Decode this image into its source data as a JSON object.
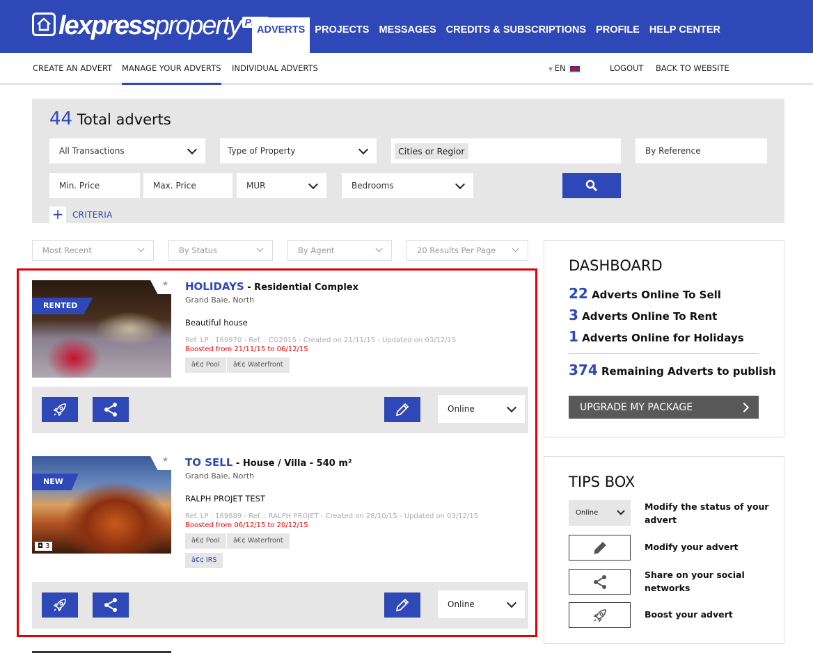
{
  "brand": {
    "name_bold": "lexpress",
    "name_light": "property",
    "pro": "PRO"
  },
  "main_nav": [
    "ADVERTS",
    "PROJECTS",
    "MESSAGES",
    "CREDITS & SUBSCRIPTIONS",
    "PROFILE",
    "HELP CENTER"
  ],
  "sub_nav": {
    "create": "CREATE AN ADVERT",
    "manage": "MANAGE YOUR ADVERTS",
    "individual": "INDIVIDUAL ADVERTS",
    "lang": "EN",
    "logout": "LOGOUT",
    "back": "BACK TO WEBSITE"
  },
  "search": {
    "total_count": "44",
    "total_label": "Total adverts",
    "transactions": "All Transactions",
    "property_type": "Type of Property",
    "cities_tag": "Cities or Regior",
    "reference": "By Reference",
    "min_price": "Min. Price",
    "max_price": "Max. Price",
    "currency": "MUR",
    "bedrooms": "Bedrooms",
    "criteria_plus": "+",
    "criteria": "CRITERIA"
  },
  "filters": {
    "sort": "Most Recent",
    "status": "By Status",
    "agent": "By Agent",
    "per_page": "20 Results Per Page"
  },
  "listings": [
    {
      "badge": "RENTED",
      "star": "★",
      "kind": "HOLIDAYS",
      "subtitle": " - Residential Complex",
      "location": "Grand Baie, North",
      "description": "Beautiful house",
      "meta": "Ref. LP : 169970 - Ref. : CG2015 - Created on 21/11/15 - Updated on 03/12/15",
      "boost": "Boosted from 21/11/15 to 06/12/15",
      "tags": [
        "â€¢ Pool",
        "â€¢ Waterfront"
      ],
      "status": "Online"
    },
    {
      "badge": "NEW",
      "star": "★",
      "photos": "3",
      "kind": "TO SELL",
      "subtitle": " - House / Villa - 540 m²",
      "location": "Grand Baie, North",
      "description": "RALPH PROJET TEST",
      "meta": "Ref. LP : 169889 - Ref. : RALPH PROJET - Created on 28/10/15 - Updated on 03/12/15",
      "boost": "Boosted from 06/12/15 to 20/12/15",
      "tags": [
        "â€¢ Pool",
        "â€¢ Waterfront"
      ],
      "tag_blue": "â€¢ IRS",
      "status": "Online"
    }
  ],
  "dashboard": {
    "title": "DASHBOARD",
    "sell_n": "22",
    "sell_label": "Adverts Online To Sell",
    "rent_n": "3",
    "rent_label": "Adverts Online To Rent",
    "hol_n": "1",
    "hol_label": "Adverts Online for Holidays",
    "remain_n": "374",
    "remain_label": "Remaining Adverts to publish",
    "upgrade": "UPGRADE MY PACKAGE"
  },
  "tips": {
    "title": "TIPS BOX",
    "status_sample": "Online",
    "status_tip": "Modify the status of your advert",
    "edit_tip": "Modify your advert",
    "share_tip": "Share on your social networks",
    "boost_tip": "Boost your advert"
  },
  "colors": {
    "brand_blue": "#2f48b7",
    "boost_red": "#e00000",
    "highlight_red": "#e00000"
  }
}
